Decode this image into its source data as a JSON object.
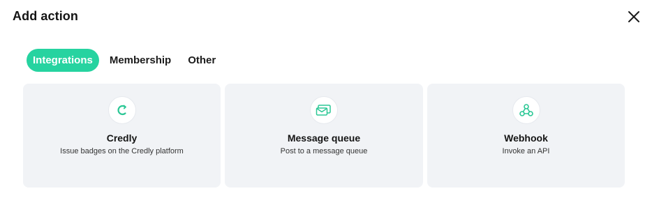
{
  "dialog": {
    "title": "Add action",
    "close_icon": "close-icon"
  },
  "tabs": [
    {
      "label": "Integrations",
      "active": true
    },
    {
      "label": "Membership",
      "active": false
    },
    {
      "label": "Other",
      "active": false
    }
  ],
  "cards": [
    {
      "title": "Credly",
      "description": "Issue badges on the Credly platform",
      "icon": "credly-icon"
    },
    {
      "title": "Message queue",
      "description": "Post to a message queue",
      "icon": "message-queue-icon"
    },
    {
      "title": "Webhook",
      "description": "Invoke an API",
      "icon": "webhook-icon"
    }
  ],
  "colors": {
    "accent": "#26d3a0",
    "card_bg": "#f1f3f6",
    "icon_green": "#2bc795"
  }
}
